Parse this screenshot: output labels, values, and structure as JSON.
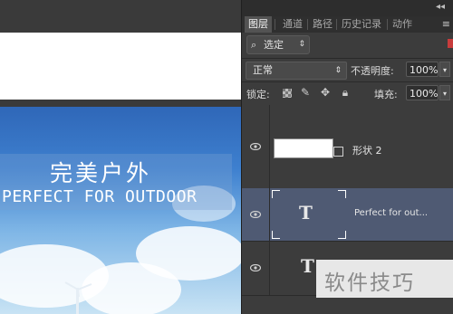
{
  "canvas": {
    "title_cn": "完美户外",
    "title_en": "PERFECT FOR OUTDOOR"
  },
  "panel": {
    "collapse_icon": "double-chevron-left-icon",
    "tabs": [
      {
        "label": "图层",
        "active": true
      },
      {
        "label": "通道",
        "active": false
      },
      {
        "label": "路径",
        "active": false
      },
      {
        "label": "历史记录",
        "active": false
      },
      {
        "label": "动作",
        "active": false
      }
    ],
    "menu_icon": "panel-menu-icon",
    "filter": {
      "label": "选定",
      "icon": "search-icon"
    },
    "blend_mode": "正常",
    "opacity_label": "不透明度:",
    "opacity_value": "100%",
    "lock_label": "锁定:",
    "fill_label": "填充:",
    "fill_value": "100%",
    "accent_red": "#c83c3c",
    "selected_color": "#4f5a73"
  },
  "layers": [
    {
      "name": "形状 2",
      "type": "shape",
      "visible": true,
      "selected": false
    },
    {
      "name": "Perfect for out...",
      "type": "text",
      "visible": true,
      "selected": true
    },
    {
      "name": "",
      "type": "text",
      "visible": true,
      "selected": false
    }
  ],
  "watermark": "软件技巧"
}
